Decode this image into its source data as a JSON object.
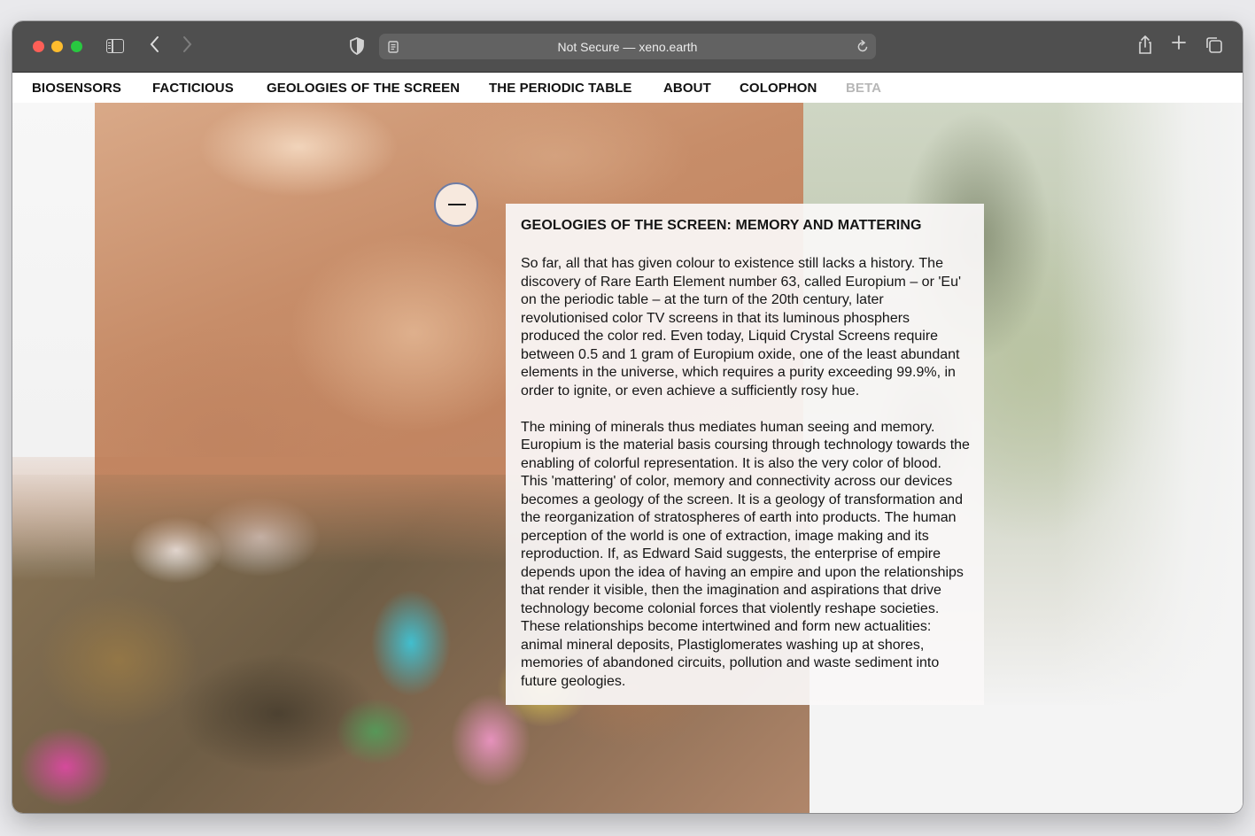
{
  "browser": {
    "address_text": "Not Secure — xeno.earth",
    "icons": [
      "sidebar-icon",
      "chevron-left-icon",
      "chevron-right-icon",
      "shield-icon",
      "reader-icon",
      "reload-icon",
      "share-icon",
      "plus-icon",
      "tabs-icon"
    ]
  },
  "nav": {
    "items": [
      {
        "label": "BIOSENSORS"
      },
      {
        "label": "FACTICIOUS"
      },
      {
        "label": "GEOLOGIES OF THE SCREEN"
      },
      {
        "label": "THE PERIODIC TABLE"
      },
      {
        "label": "ABOUT"
      },
      {
        "label": "COLOPHON"
      },
      {
        "label": "BETA"
      }
    ]
  },
  "article": {
    "title": "GEOLOGIES OF THE SCREEN: MEMORY AND MATTERING",
    "paragraphs": [
      "So far, all that has given colour to existence still lacks a history. The discovery of Rare Earth Element number 63, called Europium – or 'Eu' on the periodic table – at the turn of the 20th century, later revolutionised color TV screens in that its luminous phosphers produced the color red. Even today, Liquid Crystal Screens require between 0.5 and 1 gram of Europium oxide, one of the least abundant elements in the universe, which requires a purity exceeding 99.9%, in order to ignite, or even achieve a sufficiently rosy hue.",
      "The mining of minerals thus mediates human seeing and memory. Europium is the material basis coursing through technology towards the enabling of colorful representation. It is also the very color of blood. This 'mattering' of color, memory and connectivity across our devices becomes a geology of the screen. It is a geology of transformation and the reorganization of stratospheres of earth into products. The human perception of the world is one of extraction, image making and its reproduction. If, as Edward Said suggests, the enterprise of empire depends upon the idea of having an empire and upon the relationships that render it visible, then the imagination and aspirations that drive technology become colonial forces that violently reshape societies. These relationships become intertwined and form new actualities: animal mineral deposits, Plastiglomerates washing up at shores, memories of abandoned circuits, pollution and waste sediment into future geologies."
    ]
  },
  "colors": {
    "toolbar": "#4f4f4f",
    "nav_beta": "#b7b7b7",
    "collapse_border": "#6e7da6"
  }
}
